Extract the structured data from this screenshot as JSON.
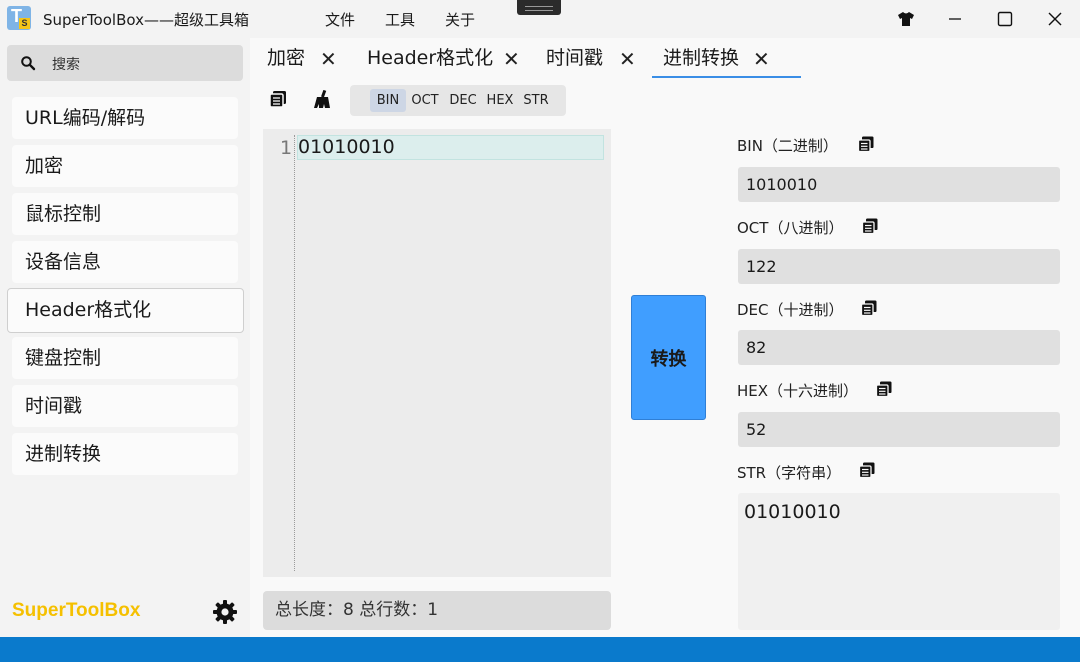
{
  "window": {
    "title": "SuperToolBox——超级工具箱",
    "logo_letter": "T",
    "logo_sub": "S"
  },
  "menu": {
    "file": "文件",
    "tools": "工具",
    "about": "关于"
  },
  "search": {
    "placeholder": "搜索"
  },
  "sidebar": {
    "items": [
      {
        "label": "URL编码/解码"
      },
      {
        "label": "加密"
      },
      {
        "label": "鼠标控制"
      },
      {
        "label": "设备信息"
      },
      {
        "label": "Header格式化"
      },
      {
        "label": "键盘控制"
      },
      {
        "label": "时间戳"
      },
      {
        "label": "进制转换"
      }
    ],
    "brand": "SuperToolBox"
  },
  "tabs": [
    {
      "label": "加密",
      "close": "✕"
    },
    {
      "label": "Header格式化",
      "close": "✕"
    },
    {
      "label": "时间戳",
      "close": "✕"
    },
    {
      "label": "进制转换",
      "close": "✕",
      "active": true
    }
  ],
  "formats": {
    "bin": "BIN",
    "oct": "OCT",
    "dec": "DEC",
    "hex": "HEX",
    "str": "STR",
    "selected": "BIN"
  },
  "editor": {
    "line_number": "1",
    "content": "01010010"
  },
  "status": {
    "text": "总长度：8 总行数：1"
  },
  "convert": {
    "label": "转换"
  },
  "results": {
    "bin": {
      "label": "BIN（二进制）",
      "value": "1010010"
    },
    "oct": {
      "label": "OCT（八进制）",
      "value": "122"
    },
    "dec": {
      "label": "DEC（十进制）",
      "value": "82"
    },
    "hex": {
      "label": "HEX（十六进制）",
      "value": "52"
    },
    "str": {
      "label": "STR（字符串）",
      "value": "01010010"
    }
  },
  "colors": {
    "accent": "#409eff",
    "brand": "#f5c000",
    "status_bar": "#0a7acc",
    "tab_underline": "#3a8ee6"
  },
  "icons": {
    "search": "search-icon",
    "settings": "gear-icon",
    "copy": "copy-icon",
    "clear": "broom-icon",
    "theme": "shirt-icon"
  }
}
